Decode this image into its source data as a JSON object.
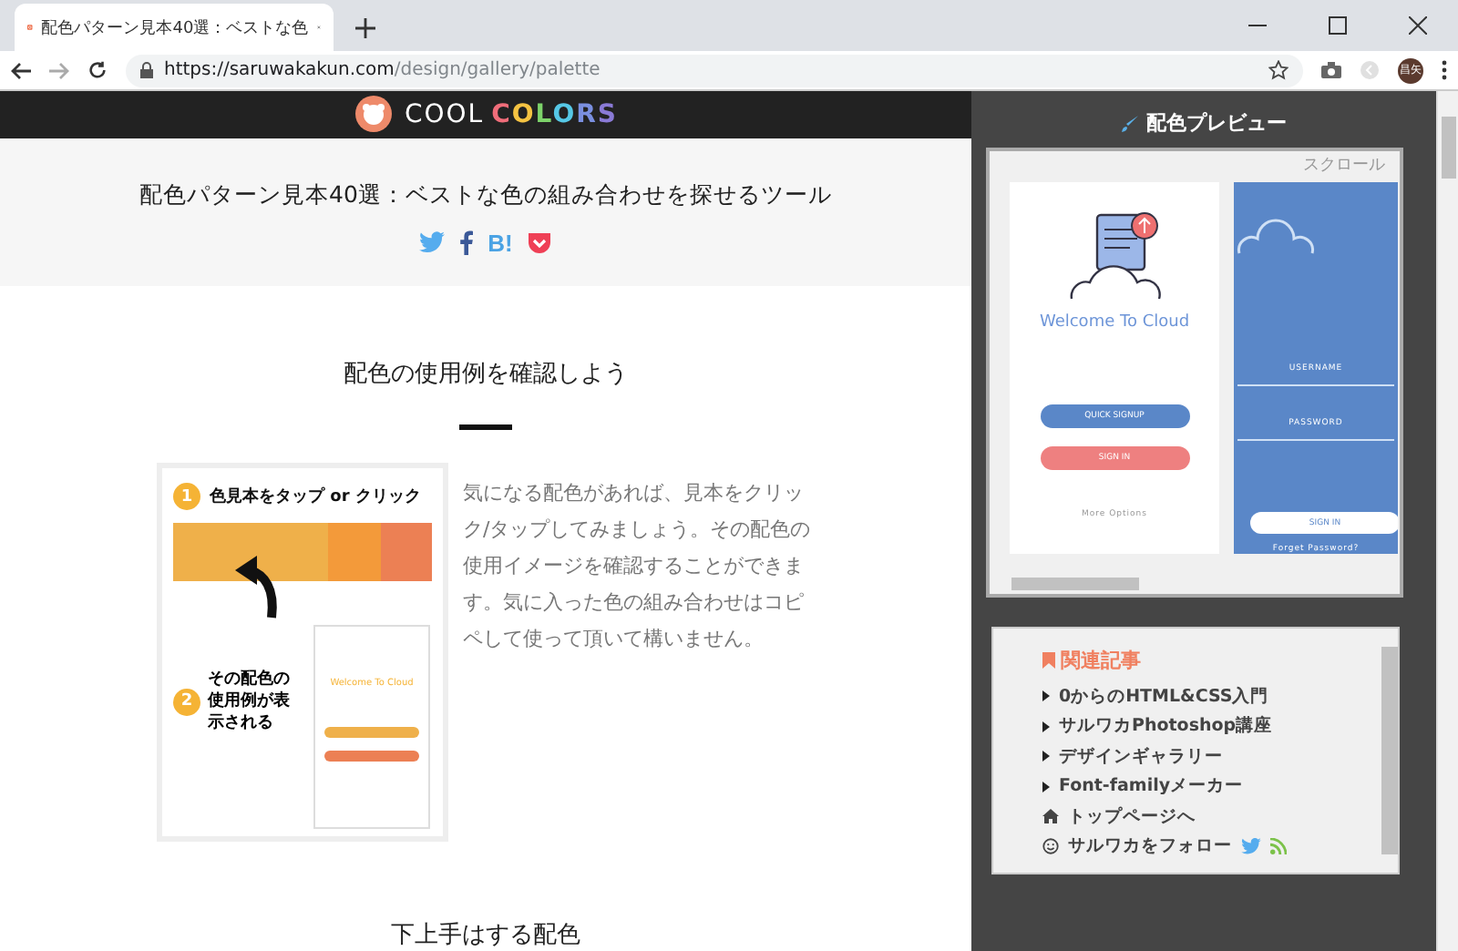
{
  "browser": {
    "tab_title": "配色パターン見本40選：ベストな色",
    "url_host": "https://saruwakakun.com",
    "url_path": "/design/gallery/palette",
    "profile": "昌矢"
  },
  "header": {
    "logo_word": "COOL",
    "logo_letters": [
      {
        "char": "C",
        "color": "#f06d7a"
      },
      {
        "char": "O",
        "color": "#f5c342"
      },
      {
        "char": "L",
        "color": "#7dd36a"
      },
      {
        "char": "O",
        "color": "#56c8e6"
      },
      {
        "char": "R",
        "color": "#7a8fe0"
      },
      {
        "char": "S",
        "color": "#8a7ad6"
      }
    ]
  },
  "hero": {
    "title": "配色パターン見本40選：ベストな色の組み合わせを探せるツール",
    "share": [
      {
        "kind": "twitter",
        "color": "#55acee"
      },
      {
        "kind": "facebook",
        "color": "#3b5998"
      },
      {
        "kind": "hatena",
        "color": "#4ba3e4",
        "label": "B!"
      },
      {
        "kind": "pocket",
        "color": "#ef4056"
      }
    ]
  },
  "section": {
    "title": "配色の使用例を確認しよう",
    "steps": [
      {
        "number": "1",
        "text": "色見本をタップ or クリック"
      },
      {
        "number": "2",
        "text": "その配色の使用例が表示される"
      }
    ],
    "swatches": [
      {
        "color": "#efb04a"
      },
      {
        "color": "#f39a3a"
      },
      {
        "color": "#ec8054"
      }
    ],
    "mini_phone": {
      "title": "Welcome To Cloud"
    },
    "paragraph": "気になる配色があれば、見本をクリック/タップしてみましょう。その配色の使用イメージを確認することができます。気に入った色の組み合わせはコピペして使って頂いて構いません。",
    "next_title": "下上手はする配色"
  },
  "preview": {
    "title": "配色プレビュー",
    "scroll_hint": "スクロール",
    "phone1": {
      "title": "Welcome To Cloud",
      "primary": "QUICK SIGNUP",
      "secondary": "SIGN IN",
      "footer": "More Options"
    },
    "phone2": {
      "field1": "USERNAME",
      "field2": "PASSWORD",
      "button": "SIGN IN",
      "link": "Forget Password?"
    }
  },
  "related": {
    "title": "関連記事",
    "items": [
      {
        "kind": "article",
        "label": "0からのHTML&CSS入門"
      },
      {
        "kind": "article",
        "label": "サルワカPhotoshop講座"
      },
      {
        "kind": "article",
        "label": "デザインギャラリー"
      },
      {
        "kind": "article",
        "label": "Font-familyメーカー"
      },
      {
        "kind": "home",
        "label": "トップページへ"
      },
      {
        "kind": "follow",
        "label": "サルワカをフォロー"
      }
    ]
  }
}
